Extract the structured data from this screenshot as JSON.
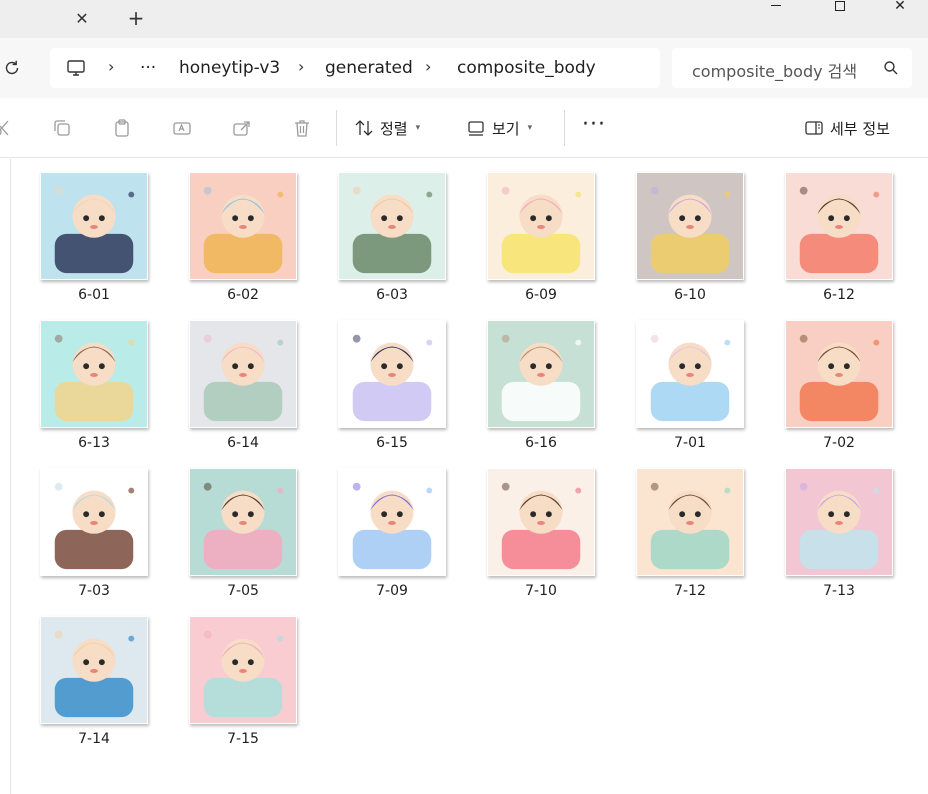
{
  "window": {
    "new_tab_glyph": "+",
    "close_tab_glyph": "✕",
    "close_glyph": "✕"
  },
  "address": {
    "ellipsis": "···",
    "crumbs": [
      "honeytip-v3",
      "generated",
      "composite_body"
    ],
    "separator_glyph": "›"
  },
  "search": {
    "placeholder": "composite_body 검색"
  },
  "toolbar": {
    "sort_label": "정렬",
    "view_label": "보기",
    "more_glyph": "···",
    "details_label": "세부 정보"
  },
  "files": [
    {
      "name": "6-01",
      "colors": [
        "#bfe3ee",
        "#2e3a5c",
        "#f3d6b7"
      ]
    },
    {
      "name": "6-02",
      "colors": [
        "#f8cfc0",
        "#f0b552",
        "#8fc2dd"
      ]
    },
    {
      "name": "6-03",
      "colors": [
        "#dcefe8",
        "#6c8a6a",
        "#f1c9a5"
      ]
    },
    {
      "name": "6-09",
      "colors": [
        "#fbeedd",
        "#f7e36a",
        "#f3a8c0"
      ]
    },
    {
      "name": "6-10",
      "colors": [
        "#cfc6c4",
        "#f1cc62",
        "#c9a4e0"
      ]
    },
    {
      "name": "6-12",
      "colors": [
        "#f9dcd6",
        "#f37d6b",
        "#5a3b2c"
      ]
    },
    {
      "name": "6-13",
      "colors": [
        "#b9ebe8",
        "#f2d58c",
        "#8a6a5a"
      ]
    },
    {
      "name": "6-14",
      "colors": [
        "#e4e6ea",
        "#a8c9b8",
        "#f0b8c8"
      ]
    },
    {
      "name": "6-15",
      "colors": [
        "#ffffff",
        "#c9c1f3",
        "#2b2e55"
      ]
    },
    {
      "name": "6-16",
      "colors": [
        "#c6e0d6",
        "#ffffff",
        "#b59275"
      ]
    },
    {
      "name": "7-01",
      "colors": [
        "#ffffff",
        "#9fd2f2",
        "#e6c5dc"
      ]
    },
    {
      "name": "7-02",
      "colors": [
        "#f9cfc3",
        "#f27a54",
        "#7a4b33"
      ]
    },
    {
      "name": "7-03",
      "colors": [
        "#ffffff",
        "#7a4b3c",
        "#b8d9e4"
      ]
    },
    {
      "name": "7-05",
      "colors": [
        "#b7dcd6",
        "#f7a8c0",
        "#4d3a2a"
      ]
    },
    {
      "name": "7-09",
      "colors": [
        "#ffffff",
        "#9fc8f2",
        "#7c6ad9"
      ]
    },
    {
      "name": "7-10",
      "colors": [
        "#fbf0e8",
        "#f37d8b",
        "#5a3a2a"
      ]
    },
    {
      "name": "7-12",
      "colors": [
        "#fbe4d0",
        "#9fd7c8",
        "#6b4a36"
      ]
    },
    {
      "name": "7-13",
      "colors": [
        "#f2c6d2",
        "#bfe4ef",
        "#c4a8e6"
      ]
    },
    {
      "name": "7-14",
      "colors": [
        "#dde9ee",
        "#3a8ec9",
        "#f3d0a6"
      ]
    },
    {
      "name": "7-15",
      "colors": [
        "#f9ccd2",
        "#a9e0dc",
        "#f3a9bf"
      ]
    }
  ]
}
